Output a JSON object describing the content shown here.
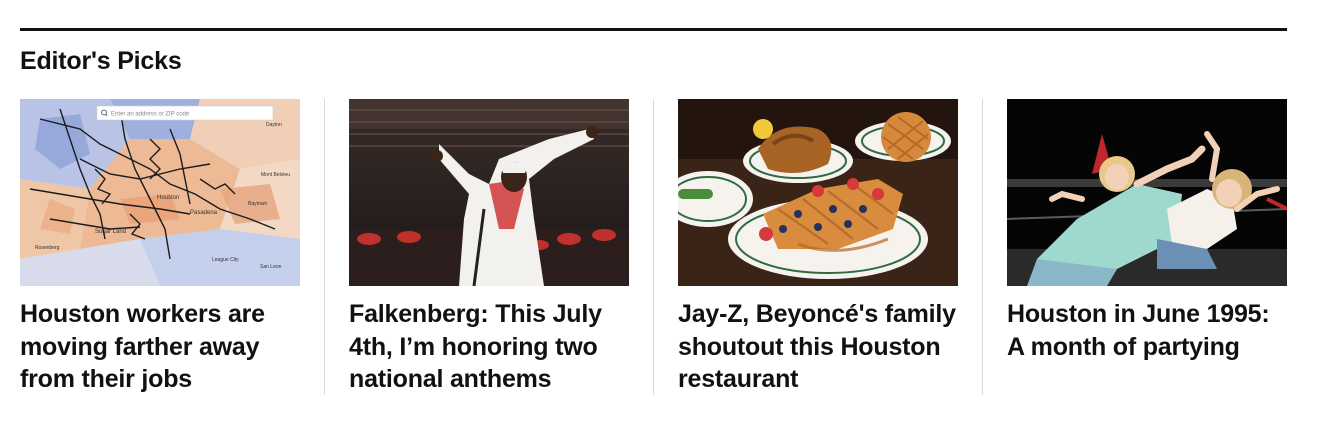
{
  "section": {
    "title": "Editor's Picks"
  },
  "cards": [
    {
      "headline": "Houston workers are moving farther away from their jobs",
      "image": "map-of-houston-commutes-image",
      "map_search_placeholder": "Enter an address or ZIP code",
      "map_labels": [
        "Houston",
        "Pasadena",
        "Sugar Land",
        "Rosenberg",
        "Baytown",
        "League City",
        "Dayton",
        "Mont Belvieu",
        "San Leon"
      ]
    },
    {
      "headline": "Falkenberg: This July 4th, I’m honoring two national anthems",
      "image": "singer-in-stadium-image"
    },
    {
      "headline": "Jay-Z, Beyoncé's family shoutout this Houston restaurant",
      "image": "chicken-and-waffles-image"
    },
    {
      "headline": "Houston in June 1995: A month of partying",
      "image": "two-women-partying-image"
    }
  ],
  "colors": {
    "rule": "#111111",
    "divider": "#d9d9d9",
    "text": "#111111"
  }
}
